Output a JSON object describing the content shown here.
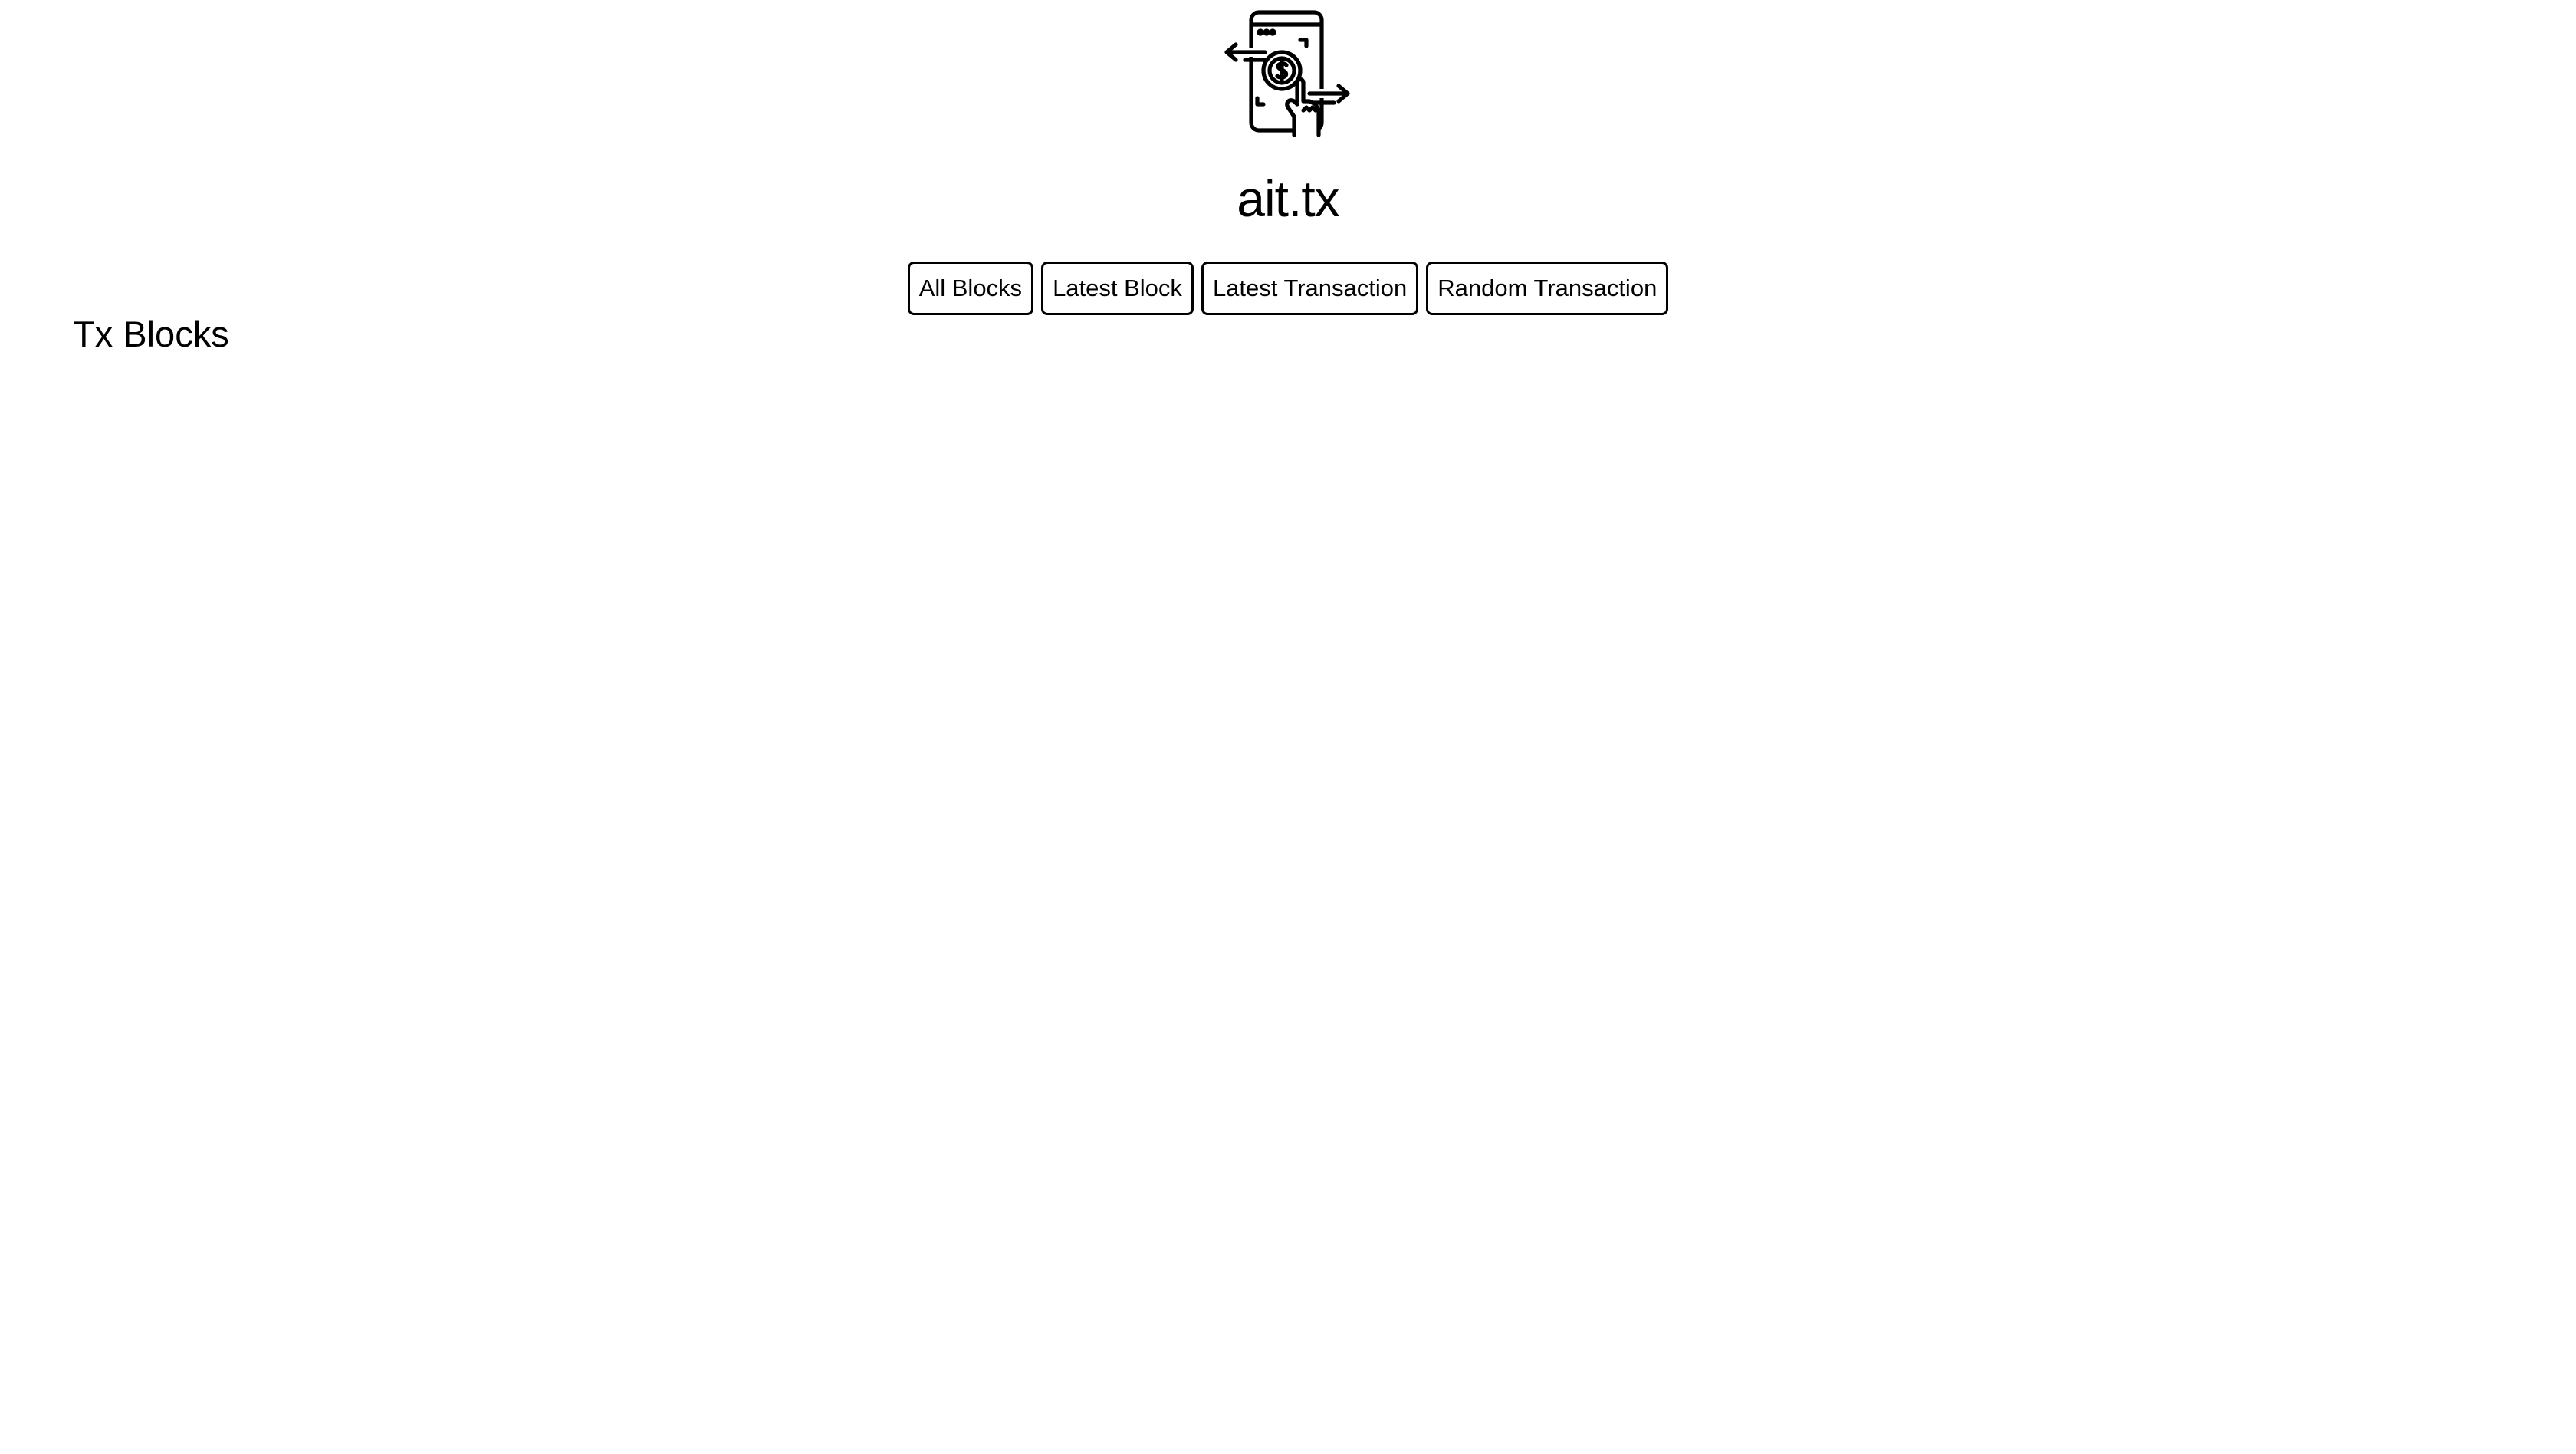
{
  "header": {
    "logo_icon": "mobile-payment-transfer-icon",
    "title": "ait.tx"
  },
  "nav": {
    "all_blocks": "All Blocks",
    "latest_block": "Latest Block",
    "latest_transaction": "Latest Transaction",
    "random_transaction": "Random Transaction"
  },
  "main": {
    "heading": "Tx Blocks"
  }
}
